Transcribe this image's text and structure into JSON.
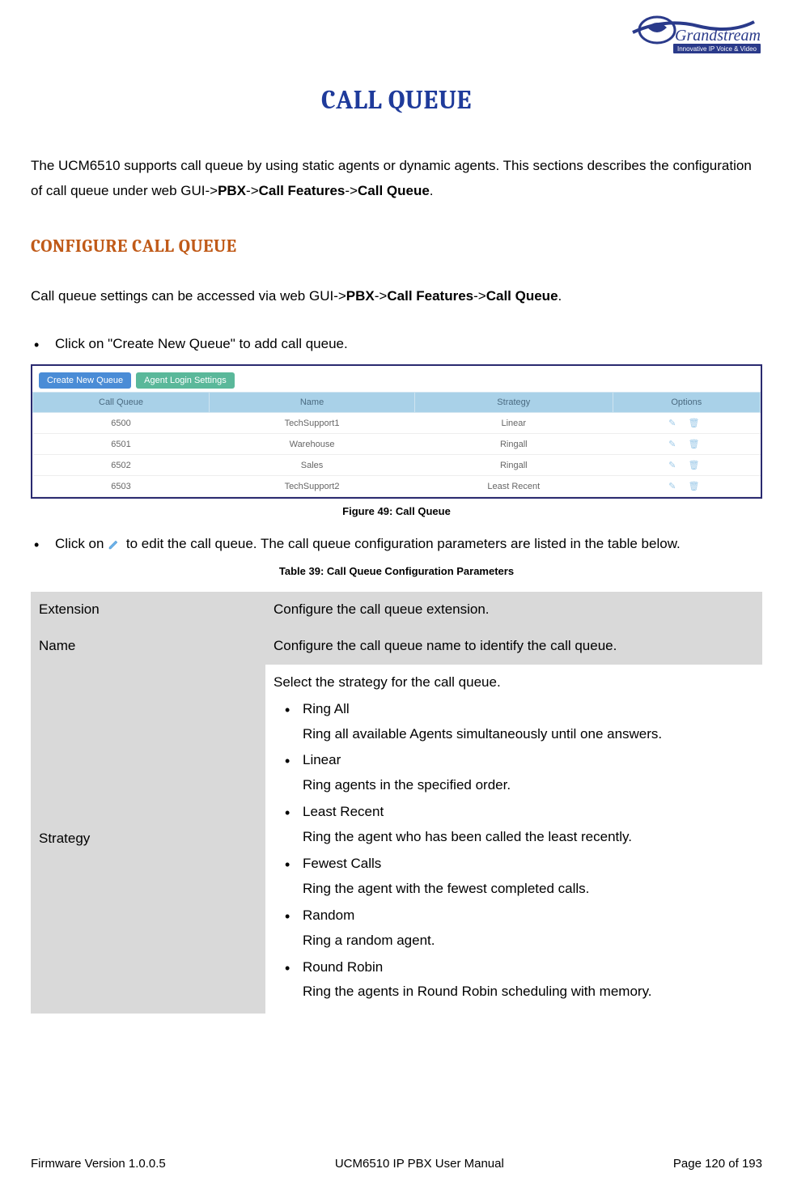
{
  "logo": {
    "brand": "Grandstream",
    "tagline": "Innovative IP Voice & Video"
  },
  "title": "CALL QUEUE",
  "intro_part1": "The UCM6510 supports call queue by using static agents or dynamic agents. This sections describes the configuration of call queue under web GUI->",
  "intro_bold1": "PBX",
  "intro_sep": "->",
  "intro_bold2": "Call Features",
  "intro_bold3": "Call Queue",
  "section_heading": "CONFIGURE CALL QUEUE",
  "body1_a": "Call queue settings can be accessed via web GUI->",
  "bullet1": "Click on \"Create New Queue\" to add call queue.",
  "screenshot": {
    "buttons": {
      "create": "Create New Queue",
      "agent": "Agent Login Settings"
    },
    "headers": [
      "Call Queue",
      "Name",
      "Strategy",
      "Options"
    ],
    "rows": [
      [
        "6500",
        "TechSupport1",
        "Linear"
      ],
      [
        "6501",
        "Warehouse",
        "Ringall"
      ],
      [
        "6502",
        "Sales",
        "Ringall"
      ],
      [
        "6503",
        "TechSupport2",
        "Least Recent"
      ]
    ]
  },
  "figure_caption": "Figure 49: Call Queue",
  "bullet2_a": "Click on ",
  "bullet2_b": " to edit the call queue. The call queue configuration parameters are listed in the table below.",
  "table_caption": "Table 39: Call Queue Configuration Parameters",
  "params": {
    "extension": {
      "label": "Extension",
      "desc": "Configure the call queue extension."
    },
    "name": {
      "label": "Name",
      "desc": "Configure the call queue name to identify the call queue."
    },
    "strategy": {
      "label": "Strategy",
      "intro": "Select the strategy for the call queue.",
      "items": [
        {
          "t": "Ring All",
          "d": "Ring all available Agents simultaneously until one answers."
        },
        {
          "t": "Linear",
          "d": "Ring agents in the specified order."
        },
        {
          "t": "Least Recent",
          "d": "Ring the agent who has been called the least recently."
        },
        {
          "t": "Fewest Calls",
          "d": "Ring the agent with the fewest completed calls."
        },
        {
          "t": "Random",
          "d": "Ring a random agent."
        },
        {
          "t": "Round Robin",
          "d": "Ring the agents in Round Robin scheduling with memory."
        }
      ]
    }
  },
  "footer": {
    "left": "Firmware Version 1.0.0.5",
    "center": "UCM6510 IP PBX User Manual",
    "right": "Page 120 of 193"
  }
}
